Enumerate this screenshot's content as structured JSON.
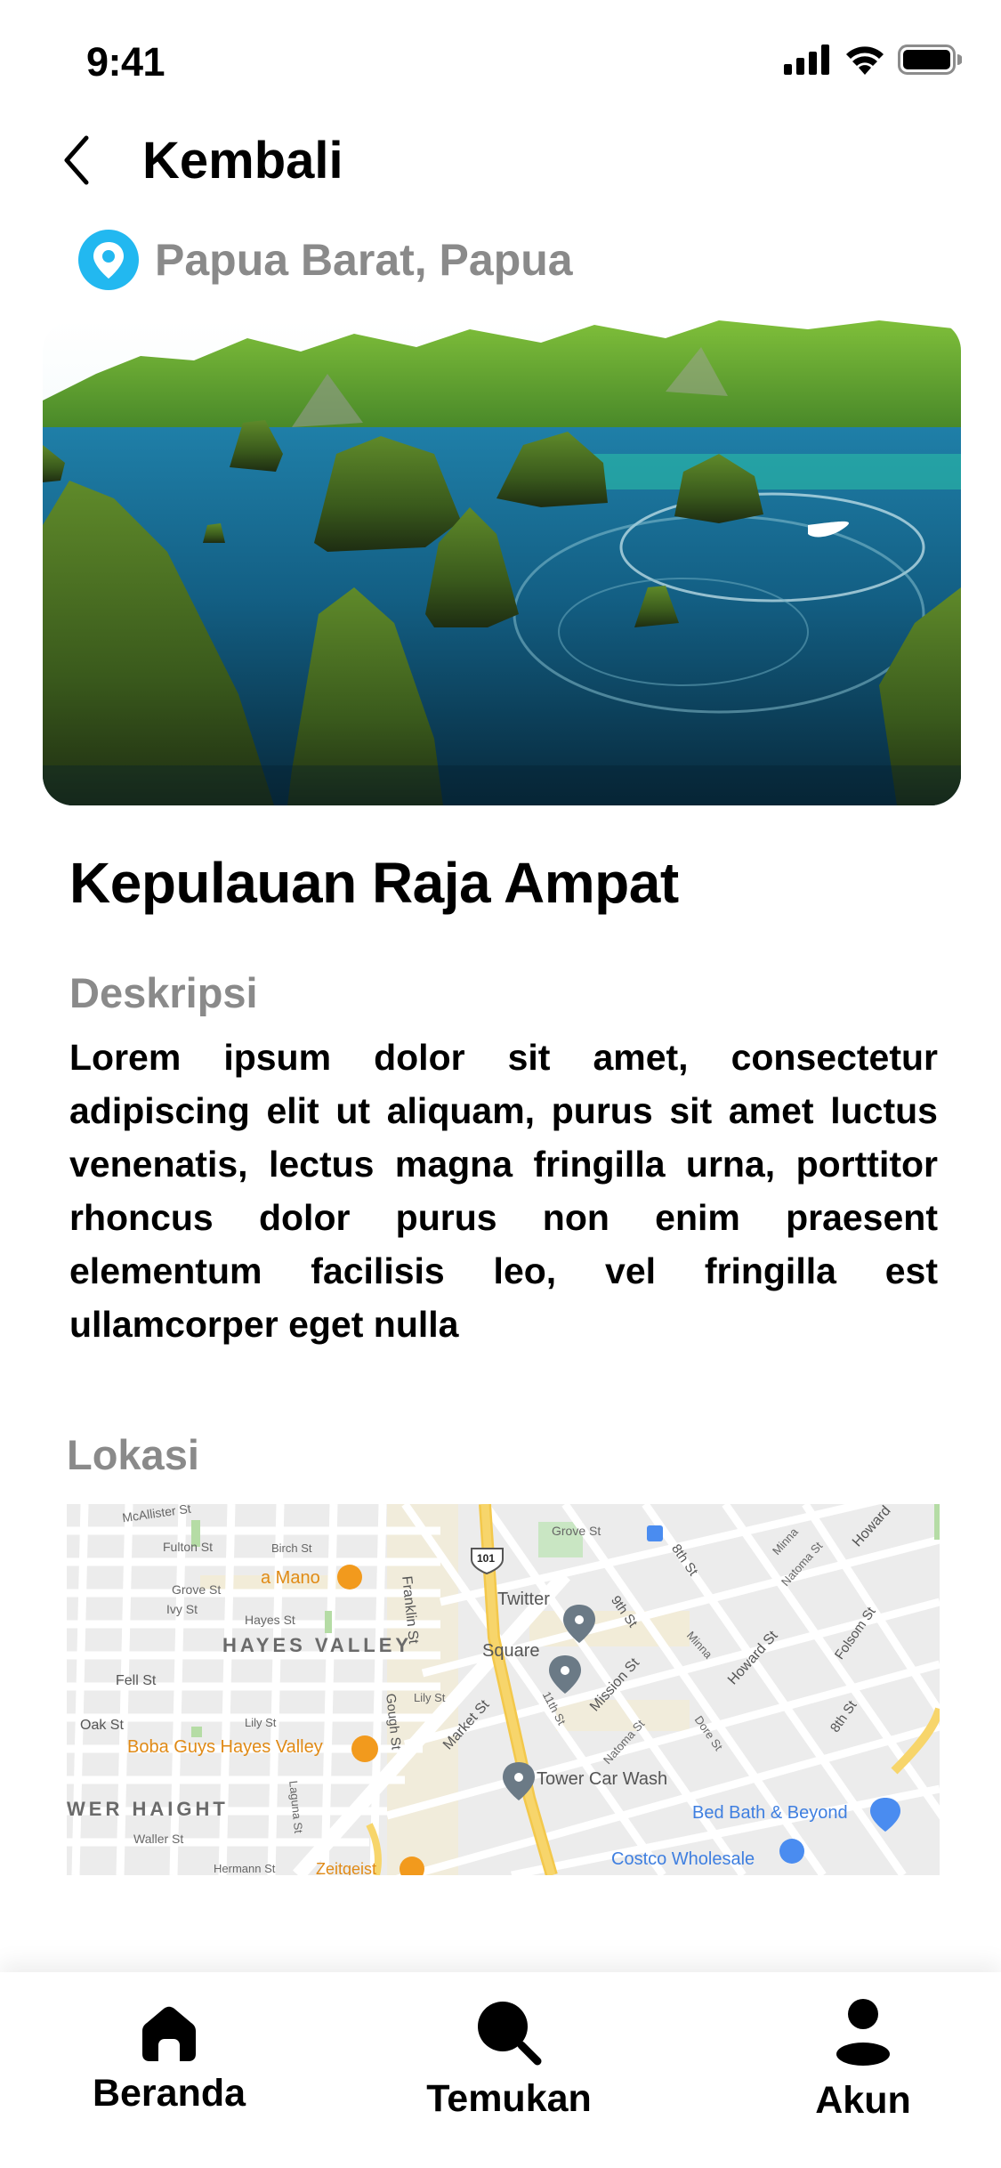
{
  "status_bar": {
    "time": "9:41"
  },
  "header": {
    "back_label": "Kembali"
  },
  "location": {
    "label": "Papua Barat, Papua"
  },
  "place": {
    "title": "Kepulauan Raja Ampat",
    "description_heading": "Deskripsi",
    "description": "Lorem ipsum dolor sit amet, consectetur adipiscing elit ut aliquam, purus sit amet luctus venenatis, lectus magna fringilla urna, porttitor rhoncus dolor purus non enim praesent elementum facilisis leo, vel fringilla est ullamcorper eget nulla",
    "location_heading": "Lokasi"
  },
  "map": {
    "labels": {
      "mcallister": "McAllister St",
      "fulton": "Fulton St",
      "grove": "Grove St",
      "grove2": "Grove St",
      "ivy": "Ivy St",
      "birch": "Birch St",
      "hayes": "Hayes St",
      "hayes_valley": "HAYES VALLEY",
      "fell": "Fell St",
      "oak": "Oak St",
      "lily": "Lily St",
      "lily2": "Lily St",
      "franklin": "Franklin St",
      "gough": "Gough St",
      "laguna": "Laguna St",
      "lower_haight": "WER HAIGHT",
      "waller": "Waller St",
      "hermann": "Hermann St",
      "market": "Market St",
      "eleventh": "11th St",
      "ninth": "9th St",
      "eighth": "8th St",
      "eighth2": "8th St",
      "mission": "Mission St",
      "natoma": "Natoma St",
      "natoma2": "Natoma St",
      "minna": "Minna",
      "minna2": "Minna",
      "howard": "Howard St",
      "howard2": "Howard",
      "folsom": "Folsom St",
      "dore": "Dore St",
      "route": "101",
      "a_mano": "a Mano",
      "boba": "Boba Guys Hayes Valley",
      "zeitgeist": "Zeitgeist",
      "twitter": "Twitter",
      "square": "Square",
      "tower": "Tower Car Wash",
      "bed_bath": "Bed Bath & Beyond",
      "costco": "Costco Wholesale"
    }
  },
  "nav": {
    "home_label": "Beranda",
    "search_label": "Temukan",
    "account_label": "Akun"
  },
  "colors": {
    "accent": "#22B8F0",
    "muted_text": "#8A8A8A",
    "poi_orange": "#F29A1D",
    "poi_gray": "#6B7A86",
    "poi_blue": "#4A8CF0",
    "map_highway": "#F7D56B"
  }
}
